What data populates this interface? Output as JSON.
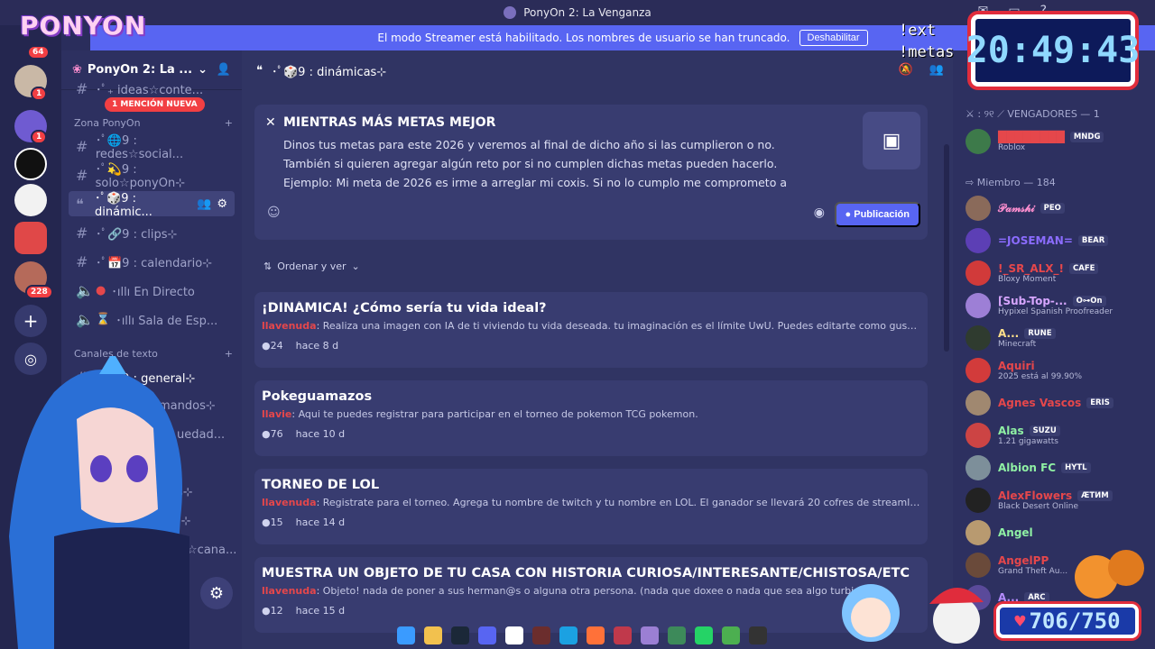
{
  "window": {
    "title": "PonyOn 2: La Venganza"
  },
  "banner": {
    "message": "El modo Streamer está habilitado. Los nombres de usuario se han truncado.",
    "button": "Deshabilitar"
  },
  "logo_text": "PONYON",
  "rail": {
    "badges": [
      "64",
      "1",
      "1",
      "228"
    ]
  },
  "sidebar": {
    "guild_name": "PonyOn 2: La ...",
    "top_partial": "･ﾟ₊ ideas☆conte...",
    "mention_pill": "1 MENCIÓN NUEVA",
    "category1": "Zona PonyOn",
    "channels": [
      {
        "name": "･ﾟ🌐9 : redes☆social..."
      },
      {
        "name": "･ﾟ💫9 : solo☆ponyOn⊹"
      },
      {
        "name": "･ﾟ🎲9 : dinámic..."
      },
      {
        "name": "･ﾟ🔗9 : clips⊹"
      },
      {
        "name": "･ﾟ📅9 : calendario⊹"
      },
      {
        "name": "･ıllı En Directo"
      },
      {
        "name": "･ıllı Sala de Esp..."
      }
    ],
    "category2": "Canales de texto",
    "text_channels": [
      {
        "name": "･ﾟ💬9 : general⊹"
      },
      {
        "name": "mandos⊹"
      },
      {
        "name": "uedad..."
      },
      {
        "name": "es⊹"
      },
      {
        "name": "irl⊹"
      },
      {
        "name": "des☆cana..."
      }
    ]
  },
  "forum": {
    "channel": "･ﾟ🎲9 : dinámicas⊹",
    "guideline": {
      "title": "MIENTRAS MÁS METAS MEJOR",
      "body": "Dinos tus metas para este 2026 y veremos al final de dicho año si las cumplieron o no. También si quieren agregar algún reto por si no cumplen dichas metas pueden hacerlo. Ejemplo: Mi meta de 2026 es irme a arreglar mi coxis. Si no lo cumplo me comprometo a",
      "publish_button": "Publicación"
    },
    "sort_label": "Ordenar y ver",
    "posts": [
      {
        "title": "¡DINÁMICA! ¿Cómo sería tu vida ideal?",
        "author": "llavenuda",
        "body": "Realiza una imagen con IA de ti viviendo tu vida deseada. tu imaginación es el límite UwU. Puedes editarte como gustes verte. (pued...",
        "count": "24",
        "time": "hace 8 d"
      },
      {
        "title": "Pokeguamazos",
        "author": "llavie",
        "body": "Aqui te puedes registrar para participar en el torneo de pokemon TCG pokemon.",
        "count": "76",
        "time": "hace 10 d"
      },
      {
        "title": "TORNEO DE LOL",
        "author": "llavenuda",
        "body": "Registrate para el torneo. Agrega tu nombre de twitch y tu nombre en LOL. El ganador se llevará 20 cofres de streamloots y un deseo...",
        "count": "15",
        "time": "hace 14 d"
      },
      {
        "title": "MUESTRA UN OBJETO DE TU CASA CON HISTORIA CURIOSA/INTERESANTE/CHISTOSA/ETC",
        "author": "llavenuda",
        "body": "Objeto! nada de poner a sus herman@s o alguna otra persona. (nada que doxee o nada que sea algo turbio pls)",
        "count": "12",
        "time": "hace 15 d"
      }
    ]
  },
  "members": {
    "group1": "⚔ : ୨୧ ⟋ VENGADORES — 1",
    "group2": "⇨ Miembro — 184",
    "list": [
      {
        "name": "████████",
        "color": "#e5474b",
        "tag": "MNDG",
        "activity": "Roblox"
      },
      {
        "name": "𝒫𝒶𝓂𝓈𝒽𝒾",
        "color": "#ff8fd0",
        "tag": "PEO",
        "activity": ""
      },
      {
        "name": "=JOSEMAN=",
        "color": "#8b6cff",
        "tag": "BEAR",
        "activity": ""
      },
      {
        "name": "!_SR_ALX_!",
        "color": "#e5474b",
        "tag": "CAFE",
        "activity": "Bloxy Moment"
      },
      {
        "name": "[Sub-Top-...",
        "color": "#d7a6ff",
        "tag": "O⊶On",
        "activity": "Hypixel Spanish Proofreader"
      },
      {
        "name": "A...",
        "color": "#ffe08a",
        "tag": "RUNE",
        "activity": "Minecraft"
      },
      {
        "name": "Aquiri",
        "color": "#e5474b",
        "tag": "",
        "activity": "2025 está al 99.90%"
      },
      {
        "name": "Agnes Vascos",
        "color": "#e5474b",
        "tag": "ERIS",
        "activity": ""
      },
      {
        "name": "Alas",
        "color": "#8ff0a4",
        "tag": "SUZU",
        "activity": "1.21 gigawatts"
      },
      {
        "name": "Albion FC",
        "color": "#8ff0a4",
        "tag": "HYTL",
        "activity": ""
      },
      {
        "name": "AlexFlowers",
        "color": "#e5474b",
        "tag": "ÆTИM",
        "activity": "Black Desert Online"
      },
      {
        "name": "Angel",
        "color": "#8ff0a4",
        "tag": "",
        "activity": ""
      },
      {
        "name": "AngelPP",
        "color": "#e5474b",
        "tag": "",
        "activity": "Grand Theft Au..."
      },
      {
        "name": "A...",
        "color": "#b58cff",
        "tag": "ARC",
        "activity": ""
      }
    ]
  },
  "overlay": {
    "commands": "!ext\n!metas",
    "clock": "20:49:43",
    "goal": "706/750"
  },
  "colors": {
    "accent": "#5865f2",
    "mention": "#f23f43",
    "online": "#23a55a"
  }
}
